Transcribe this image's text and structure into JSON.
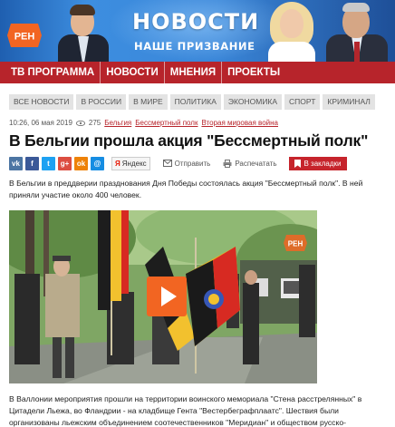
{
  "banner": {
    "title": "НОВОСТИ",
    "subtitle": "НАШЕ ПРИЗВАНИЕ",
    "logo_text": "РЕН",
    "colors": {
      "primary": "#2e7bd0",
      "logo": "#f26522"
    }
  },
  "main_nav": {
    "items": [
      {
        "label": "ТВ ПРОГРАММА"
      },
      {
        "label": "НОВОСТИ"
      },
      {
        "label": "МНЕНИЯ"
      },
      {
        "label": "ПРОЕКТЫ"
      }
    ],
    "color": "#b7242b"
  },
  "categories": [
    {
      "label": "ВСЕ НОВОСТИ"
    },
    {
      "label": "В РОССИИ"
    },
    {
      "label": "В МИРЕ"
    },
    {
      "label": "ПОЛИТИКА"
    },
    {
      "label": "ЭКОНОМИКА"
    },
    {
      "label": "СПОРТ"
    },
    {
      "label": "КРИМИНАЛ"
    }
  ],
  "meta": {
    "datetime": "10:26, 06 мая 2019",
    "views": "275",
    "tags": [
      "Бельгия",
      "Бессмертный полк",
      "Вторая мировая война"
    ]
  },
  "article": {
    "headline": "В Бельгии прошла акция \"Бессмертный полк\"",
    "lead": "В Бельгии в преддверии празднования Дня Победы состоялась акция \"Бессмертный полк\". В ней приняли участие около 400 человек.",
    "paragraph": "В Валлонии мероприятия прошли на территории воинского мемориала \"Стена расстрелянных\" в Цитадели Льежа, во Фландрии - на кладбище Гента \"Вестербеграфплаатс\". Шествия были организованы льежским объединением соотечественников \"Меридиан\" и обществом русско-"
  },
  "share": {
    "icons": [
      {
        "name": "vk-icon",
        "glyph": "vk"
      },
      {
        "name": "facebook-icon",
        "glyph": "f"
      },
      {
        "name": "twitter-icon",
        "glyph": "t"
      },
      {
        "name": "google-plus-icon",
        "glyph": "g+"
      },
      {
        "name": "odnoklassniki-icon",
        "glyph": "ok"
      },
      {
        "name": "mail-ru-icon",
        "glyph": "@"
      }
    ],
    "yandex_label": "Яндекс",
    "yandex_badge": "Я",
    "send_label": "Отправить",
    "print_label": "Распечатать",
    "bookmark_label": "В закладки"
  },
  "video": {
    "logo_text": "РЕН",
    "play_icon": "play-icon"
  }
}
